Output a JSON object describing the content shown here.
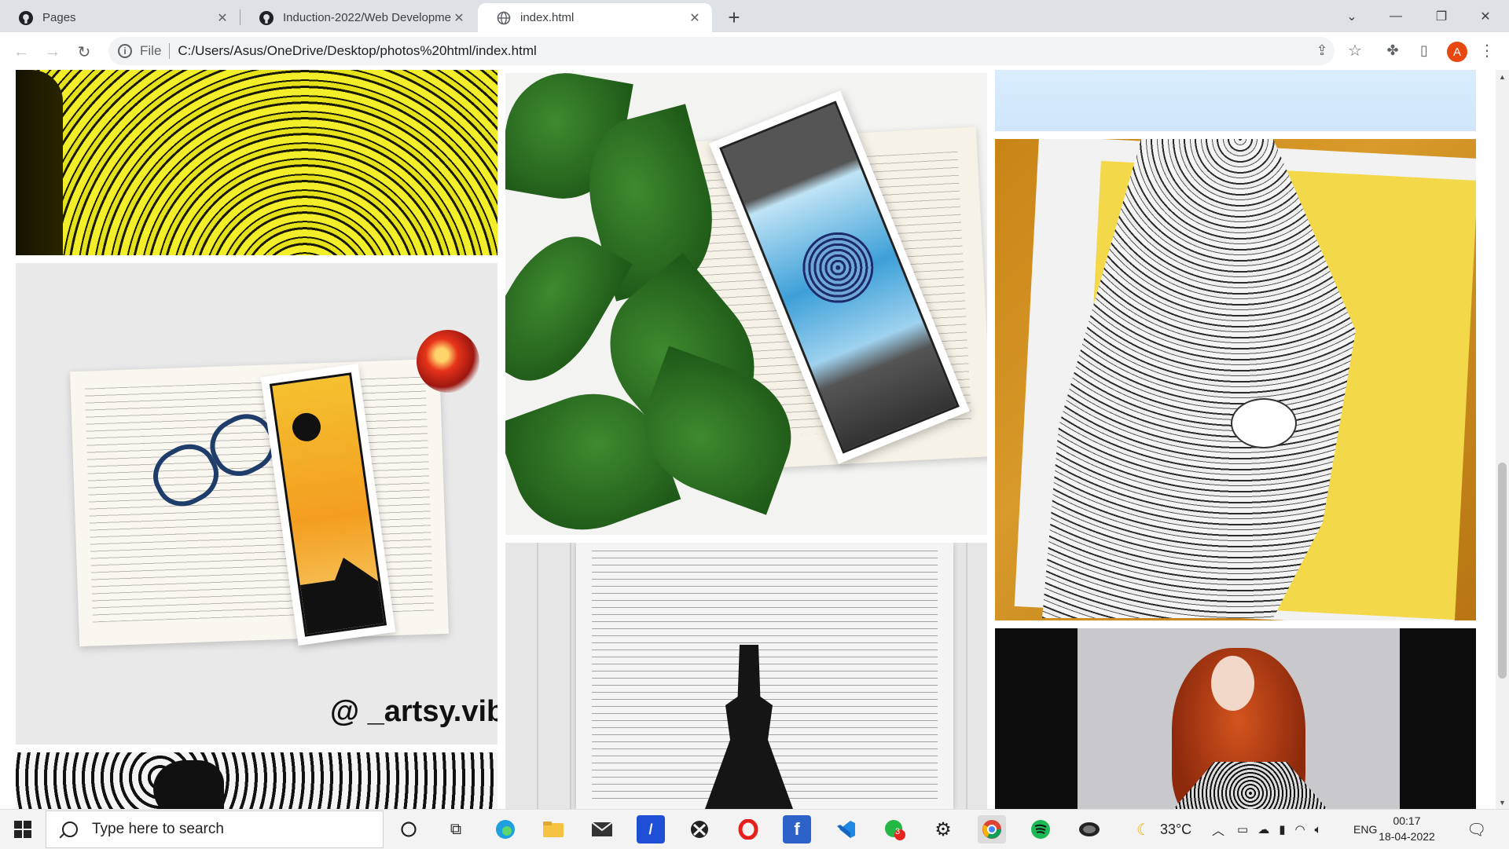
{
  "browser": {
    "tabs": [
      {
        "title": "Pages",
        "icon": "github-icon",
        "active": false
      },
      {
        "title": "Induction-2022/Web Developme",
        "icon": "github-icon",
        "active": false
      },
      {
        "title": "index.html",
        "icon": "globe-icon",
        "active": true
      }
    ],
    "address": {
      "scheme_label": "File",
      "url": "C:/Users/Asus/OneDrive/Desktop/photos%20html/index.html"
    },
    "profile_initial": "A"
  },
  "page": {
    "photos": [
      {
        "name": "yellow-mandala-photo"
      },
      {
        "name": "sunset-bookmark-photo",
        "watermark": "@ _artsy.vibes"
      },
      {
        "name": "black-white-pattern-photo"
      },
      {
        "name": "leaves-mandala-bookmark-photo"
      },
      {
        "name": "girl-sketch-photo"
      },
      {
        "name": "sky-photo"
      },
      {
        "name": "peacock-mandala-photo"
      },
      {
        "name": "red-hair-girl-photo"
      }
    ]
  },
  "taskbar": {
    "search_placeholder": "Type here to search",
    "weather": "33°C",
    "language": "ENG",
    "time": "00:17",
    "date": "18-04-2022",
    "whatsapp_badge": "3"
  },
  "colors": {
    "accent_avatar": "#e8470f",
    "tabstrip_bg": "#dee1e6"
  }
}
